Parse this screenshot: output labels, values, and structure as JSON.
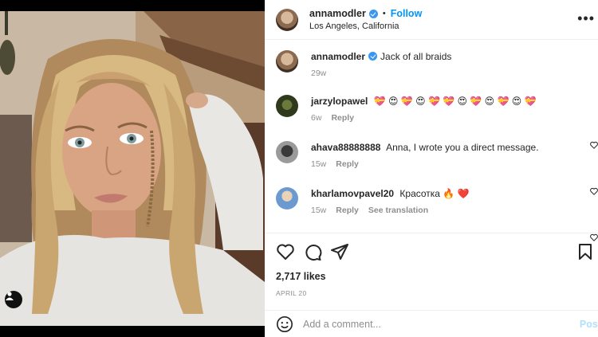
{
  "post": {
    "author": "annamodler",
    "follow_label": "Follow",
    "separator": "•",
    "location": "Los Angeles, California",
    "more_label": "•••",
    "caption": {
      "username": "annamodler",
      "text": "Jack of all braids",
      "age": "29w"
    },
    "comments": [
      {
        "username": "jarzylopawel",
        "text": "💝 😍 💝 😍 💝 💝 😍 💝 😍 💝 😍 💝",
        "age": "6w",
        "reply_label": "Reply",
        "extra": ""
      },
      {
        "username": "ahava88888888",
        "text": "Anna, I wrote you a direct message.",
        "age": "15w",
        "reply_label": "Reply",
        "extra": ""
      },
      {
        "username": "kharlamovpavel20",
        "text": "Красотка 🔥 ❤️",
        "age": "15w",
        "reply_label": "Reply",
        "extra": "See translation"
      }
    ],
    "likes": "2,717 likes",
    "date": "APRIL 20",
    "comment_box": {
      "placeholder": "Add a comment...",
      "post_label": "Post"
    }
  },
  "icons": {
    "like": "heart-icon",
    "comment": "comment-icon",
    "share": "paper-plane-icon",
    "save": "bookmark-icon",
    "emoji": "smiley-icon",
    "tag": "user-tag-icon"
  },
  "colors": {
    "follow": "#0095f6",
    "verified": "#3897f0",
    "post_disabled": "#b2dffc",
    "meta": "#8e8e8e"
  }
}
